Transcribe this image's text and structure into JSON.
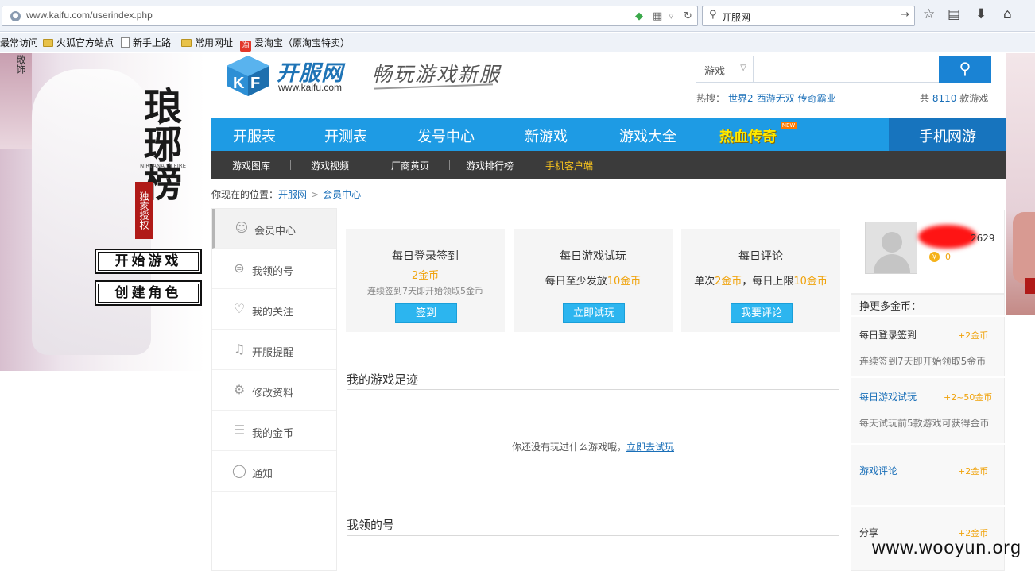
{
  "browser": {
    "url": "www.kaifu.com/userindex.php",
    "search_value": "开服网",
    "bookmarks": [
      "最常访问",
      "火狐官方站点",
      "新手上路",
      "常用网址",
      "爱淘宝（原淘宝特卖）"
    ]
  },
  "ad_left": {
    "tiny_text": "敬饰",
    "calligraphy": "琅琊榜",
    "brand_small": "NIRVANA IN FIRE",
    "seal": "独家授权",
    "buttons": [
      "开始游戏",
      "创建角色"
    ]
  },
  "header": {
    "logo_text": "开服网",
    "logo_url": "www.kaifu.com",
    "slogan": "畅玩游戏新服",
    "search_category": "游戏",
    "search_placeholder": "",
    "hot_label": "热搜：",
    "hot_keywords": [
      "世界2",
      "西游无双",
      "传奇霸业"
    ],
    "count_prefix": "共",
    "count_value": "8110",
    "count_suffix": "款游戏"
  },
  "nav": {
    "items": [
      "开服表",
      "开测表",
      "发号中心",
      "新游戏",
      "游戏大全",
      "热血传奇"
    ],
    "new_badge": "NEW",
    "mobile": "手机网游"
  },
  "subnav": {
    "items": [
      "游戏图库",
      "游戏视频",
      "厂商黄页",
      "游戏排行榜",
      "手机客户端"
    ]
  },
  "breadcrumb": {
    "prefix": "你现在的位置：",
    "home": "开服网",
    "current": "会员中心"
  },
  "sidebar": {
    "items": [
      "会员中心",
      "我领的号",
      "我的关注",
      "开服提醒",
      "修改资料",
      "我的金币",
      "通知"
    ]
  },
  "tasks": [
    {
      "title": "每日登录签到",
      "coin_text": "2金币",
      "desc": "连续签到7天即开始领取5金币",
      "button": "签到"
    },
    {
      "title": "每日游戏试玩",
      "desc_a": "每日至少发放",
      "coin_text": "10金币",
      "button": "立即试玩"
    },
    {
      "title": "每日评论",
      "desc_a": "单次",
      "coin_a": "2金币",
      "desc_b": "，每日上限",
      "coin_b": "10金币",
      "button": "我要评论"
    }
  ],
  "footprint": {
    "title": "我的游戏足迹",
    "empty": "你还没有玩过什么游戏哦，",
    "link": "立即去试玩"
  },
  "claimed": {
    "title": "我领的号"
  },
  "user": {
    "name_suffix": "2629",
    "coins": "0"
  },
  "earn": {
    "title": "挣更多金币：",
    "items": [
      {
        "name": "每日登录签到",
        "points": "+2金币",
        "desc": "连续签到7天即开始领取5金币"
      },
      {
        "name": "每日游戏试玩",
        "points": "+2~50金币",
        "desc": "每天试玩前5款游戏可获得金币"
      },
      {
        "name": "游戏评论",
        "points": "+2金币"
      },
      {
        "name": "分享",
        "points": "+2金币"
      }
    ]
  },
  "watermark": "www.wooyun.org",
  "colors": {
    "nav_blue": "#1e9be4",
    "sub_dark": "#3b3b3b",
    "button_blue": "#2cb5ef",
    "coin_orange": "#f0a30c",
    "link_blue": "#1a6fb8"
  }
}
